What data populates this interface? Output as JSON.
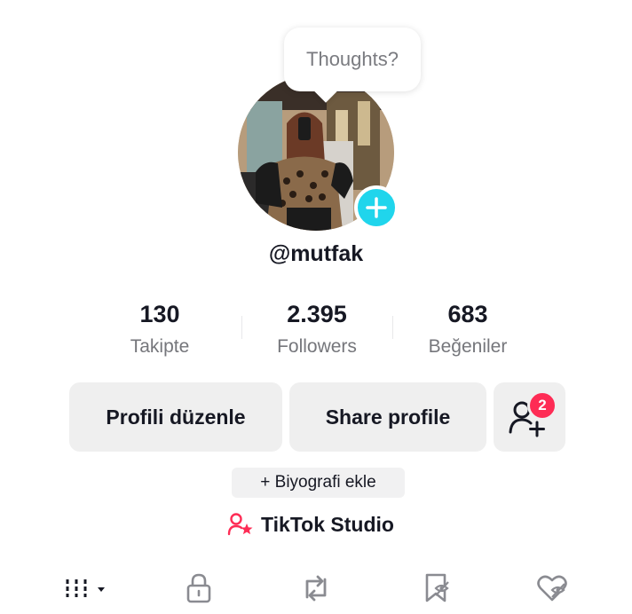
{
  "profile": {
    "comment_bubble": "Thoughts?",
    "username": "@mutfak"
  },
  "stats": [
    {
      "value": "130",
      "label": "Takipte"
    },
    {
      "value": "2.395",
      "label": "Followers"
    },
    {
      "value": "683",
      "label": "Beğeniler"
    }
  ],
  "actions": {
    "edit_profile": "Profili düzenle",
    "share_profile": "Share profile",
    "friends_badge": "2"
  },
  "bio_button": "+ Biyografi ekle",
  "studio_link": "TikTok Studio",
  "tabs": [
    {
      "icon": "grid-icon",
      "selected": true
    },
    {
      "icon": "lock-icon"
    },
    {
      "icon": "repost-icon"
    },
    {
      "icon": "bookmark-icon"
    },
    {
      "icon": "liked-icon"
    }
  ],
  "colors": {
    "accent_cyan": "#20d5ec",
    "badge_red": "#fe2c55",
    "button_bg": "#efefef",
    "text_primary": "#161823",
    "text_secondary": "#75767b"
  }
}
